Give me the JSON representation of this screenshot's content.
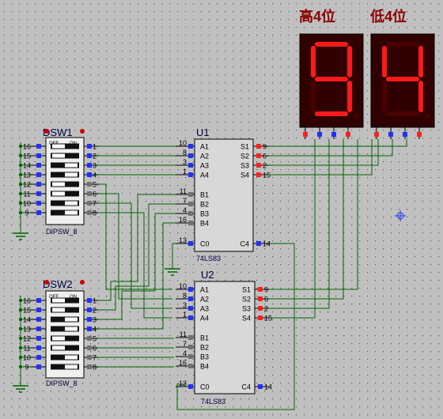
{
  "colors": {
    "background": "#c0c0c0",
    "wire": "#006400",
    "chip_fill": "#d8d8d8",
    "chip_stroke": "#000000",
    "pin_blue": "#2030ff",
    "pin_red": "#ff2020",
    "pin_gray": "#707070",
    "segment_on": "#ff1a1a",
    "segment_off": "#4a0000",
    "display_bg": "#300000",
    "title_color": "#8b0000",
    "label_color": "#000040",
    "switch_body": "#f0f0f0"
  },
  "displays": {
    "high": {
      "title": "高4位",
      "digit": "9"
    },
    "low": {
      "title": "低4位",
      "digit": "4"
    }
  },
  "dipsw1": {
    "name": "DSW1",
    "type": "DIPSW_8",
    "off_label": "OFF",
    "on_label": "ON",
    "left_pins": [
      "16",
      "15",
      "14",
      "13",
      "12",
      "11",
      "10",
      "9"
    ],
    "right_pins": [
      "1",
      "2",
      "3",
      "4",
      "5",
      "6",
      "7",
      "8"
    ],
    "states": [
      false,
      false,
      true,
      true,
      false,
      false,
      true,
      true
    ]
  },
  "dipsw2": {
    "name": "DSW2",
    "type": "DIPSW_8",
    "off_label": "OFF",
    "on_label": "ON",
    "left_pins": [
      "16",
      "15",
      "14",
      "13",
      "12",
      "11",
      "10",
      "9"
    ],
    "right_pins": [
      "1",
      "2",
      "3",
      "4",
      "5",
      "6",
      "7",
      "8"
    ],
    "states": [
      false,
      false,
      true,
      true,
      false,
      false,
      true,
      true
    ]
  },
  "u1": {
    "ref": "U1",
    "part": "74LS83",
    "left_labels": [
      "A1",
      "A2",
      "A3",
      "A4",
      "B1",
      "B2",
      "B3",
      "B4",
      "C0"
    ],
    "left_pins": [
      "10",
      "8",
      "3",
      "1",
      "11",
      "7",
      "4",
      "16",
      "13"
    ],
    "right_labels": [
      "S1",
      "S2",
      "S3",
      "S4",
      "C4"
    ],
    "right_pins": [
      "9",
      "6",
      "2",
      "15",
      "14"
    ]
  },
  "u2": {
    "ref": "U2",
    "part": "74LS83",
    "left_labels": [
      "A1",
      "A2",
      "A3",
      "A4",
      "B1",
      "B2",
      "B3",
      "B4",
      "C0"
    ],
    "left_pins": [
      "10",
      "8",
      "3",
      "1",
      "11",
      "7",
      "4",
      "16",
      "13"
    ],
    "right_labels": [
      "S1",
      "S2",
      "S3",
      "S4",
      "C4"
    ],
    "right_pins": [
      "9",
      "6",
      "2",
      "15",
      "14"
    ]
  }
}
